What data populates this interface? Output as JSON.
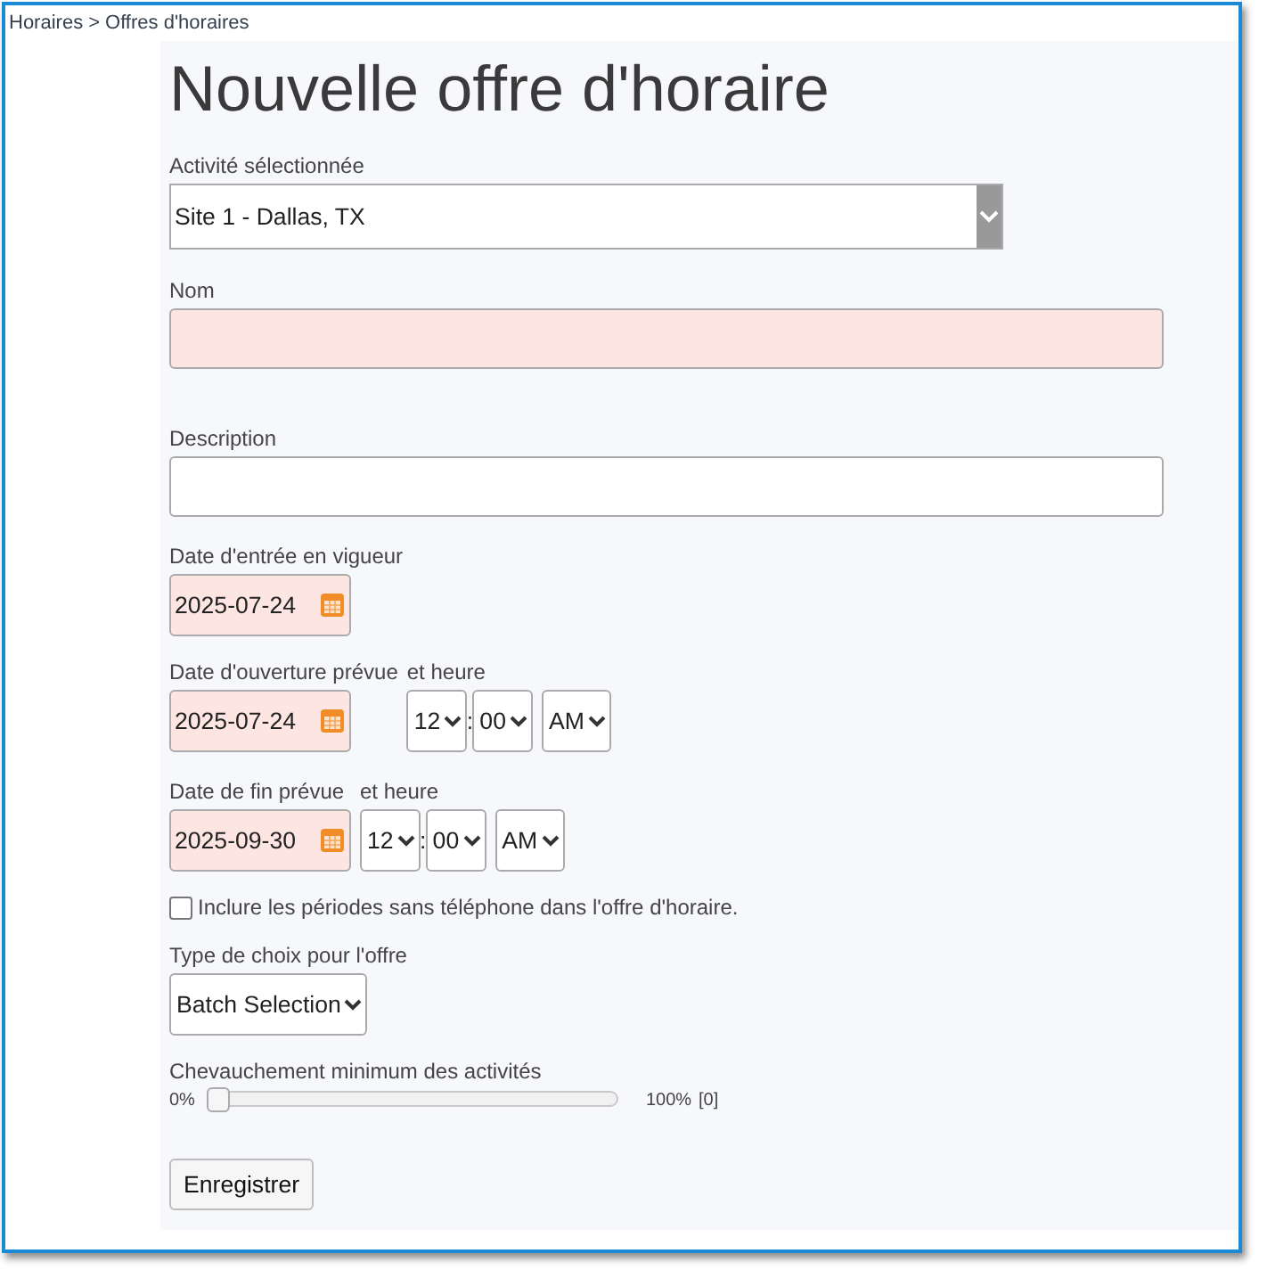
{
  "breadcrumb": {
    "items": [
      "Horaires",
      "Offres d'horaires"
    ],
    "separator": ">"
  },
  "title": "Nouvelle offre d'horaire",
  "activity": {
    "label": "Activité sélectionnée",
    "value": "Site 1 - Dallas, TX"
  },
  "name": {
    "label": "Nom",
    "required": true
  },
  "description": {
    "label": "Description",
    "required": false
  },
  "effective_date": {
    "label": "Date d'entrée en vigueur",
    "value": "2025-07-24",
    "required": true
  },
  "open_date": {
    "label": "Date d'ouverture prévue",
    "value": "2025-07-24",
    "required": true,
    "time_label": "et heure",
    "hour": "12",
    "time_separator": ":",
    "minute": "00",
    "period": "AM"
  },
  "end_date": {
    "label": "Date de fin prévue",
    "value": "2025-09-30",
    "required": true,
    "time_label": "et heure",
    "hour": "12",
    "time_separator": ":",
    "minute": "00",
    "period": "AM"
  },
  "include_no_phone": {
    "label": "Inclure les périodes sans téléphone dans l'offre d'horaire.",
    "checked": false
  },
  "choice_type": {
    "label": "Type de choix pour l'offre",
    "value": "Batch Selection"
  },
  "overlap": {
    "label": "Chevauchement minimum des activités",
    "min_label": "0%",
    "max_label": "100%",
    "reading": "[0]",
    "level": 0
  },
  "save_button": {
    "label": "Enregistrer"
  }
}
